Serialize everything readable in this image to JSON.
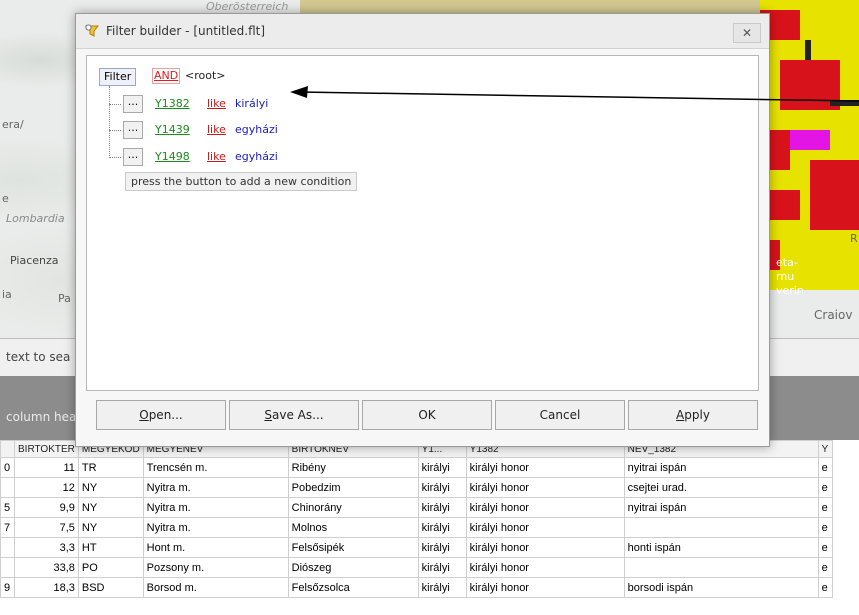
{
  "map": {
    "labels": [
      {
        "text": "era/"
      },
      {
        "text": "e"
      },
      {
        "text": "Lombardia"
      },
      {
        "text": "Piacenza"
      },
      {
        "text": "ia"
      },
      {
        "text": "Pa"
      },
      {
        "text": "Oberösterreich"
      },
      {
        "text": "eta-"
      },
      {
        "text": "rnu"
      },
      {
        "text": "verin"
      },
      {
        "text": "Craiov"
      },
      {
        "text": "R"
      }
    ]
  },
  "search": {
    "text": "text to sea"
  },
  "grid_hint": {
    "text": "column hea"
  },
  "dialog": {
    "title": "Filter builder - [untitled.flt]",
    "close_icon": "close-icon",
    "filter_label": "Filter",
    "group_operator": "AND",
    "root_label": "<root>",
    "conditions": [
      {
        "field": "Y1382",
        "op": "like",
        "value": "királyi"
      },
      {
        "field": "Y1439",
        "op": "like",
        "value": "egyházi"
      },
      {
        "field": "Y1498",
        "op": "like",
        "value": "egyházi"
      }
    ],
    "dots_label": "...",
    "add_hint": "press the button to add a new condition",
    "buttons": {
      "open": {
        "pre": "",
        "u": "O",
        "post": "pen..."
      },
      "save_as": {
        "pre": "",
        "u": "S",
        "post": "ave As..."
      },
      "ok": "OK",
      "cancel": "Cancel",
      "apply": {
        "pre": "",
        "u": "A",
        "post": "pply"
      }
    }
  },
  "table": {
    "headers": [
      "",
      "BIRTOKTER",
      "MEGYEKOD",
      "MEGYENEV",
      "BIRTOKNEV",
      "Y1...",
      "Y1382",
      "NEV_1382",
      "Y"
    ],
    "rows": [
      [
        "0",
        "11",
        "TR",
        "Trencsén m.",
        "Ribény",
        "királyi",
        "királyi honor",
        "nyitrai ispán",
        "e"
      ],
      [
        "",
        "12",
        "NY",
        "Nyitra m.",
        "Pobedzim",
        "királyi",
        "királyi honor",
        "csejtei urad.",
        "e"
      ],
      [
        "5",
        "9,9",
        "NY",
        "Nyitra m.",
        "Chinorány",
        "királyi",
        "királyi honor",
        "nyitrai ispán",
        "e"
      ],
      [
        "7",
        "7,5",
        "NY",
        "Nyitra m.",
        "Molnos",
        "királyi",
        "királyi honor",
        "",
        "e"
      ],
      [
        "",
        "3,3",
        "HT",
        "Hont m.",
        "Felsősipék",
        "királyi",
        "királyi honor",
        "honti ispán",
        "e"
      ],
      [
        "",
        "33,8",
        "PO",
        "Pozsony m.",
        "Diószeg",
        "királyi",
        "királyi honor",
        "",
        "e"
      ],
      [
        "9",
        "18,3",
        "BSD",
        "Borsod m.",
        "Felsőzsolca",
        "királyi",
        "királyi honor",
        "borsodi ispán",
        "e"
      ]
    ]
  }
}
